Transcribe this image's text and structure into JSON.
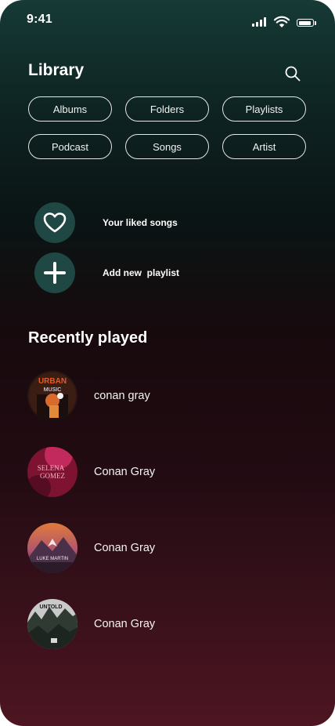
{
  "status_bar": {
    "time": "9:41"
  },
  "header": {
    "title": "Library"
  },
  "filters": [
    "Albums",
    "Folders",
    "Playlists",
    "Podcast",
    "Songs",
    "Artist"
  ],
  "actions": {
    "liked": "Your liked songs",
    "add_playlist": "Add new  playlist"
  },
  "recent": {
    "title": "Recently played",
    "items": [
      {
        "name": "conan gray",
        "art_text_1": "URBAN",
        "art_text_2": "MUSIC"
      },
      {
        "name": "Conan Gray",
        "art_text_1": "SELENA",
        "art_text_2": "GOMEZ"
      },
      {
        "name": "Conan Gray",
        "art_text_1": "LUKE MARTIN"
      },
      {
        "name": "Conan Gray",
        "art_text_1": "UNTOLD"
      }
    ]
  },
  "colors": {
    "chip_border": "#e6e6e6",
    "action_circle": "#1f4744"
  }
}
